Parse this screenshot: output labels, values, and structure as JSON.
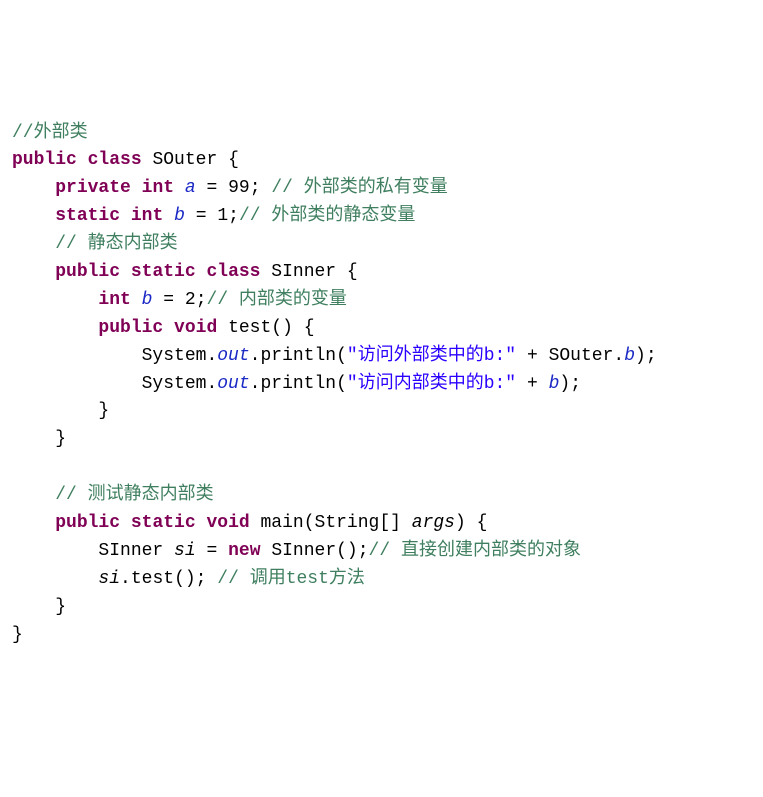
{
  "c": {
    "l1": "//外部类",
    "l4a": "// ",
    "l4b": "外部类的私有变量",
    "l5a": "// ",
    "l5b": "外部类的静态变量",
    "l6": "// 静态内部类",
    "l8a": "// ",
    "l8b": "内部类的变量",
    "l15": "// 测试静态内部类",
    "l17a": "// ",
    "l17b": "直接创建内部类的对象",
    "l18a": "// ",
    "l18b": "调用test方法"
  },
  "kw": {
    "public": "public",
    "class": "class",
    "private": "private",
    "int": "int",
    "static": "static",
    "void": "void",
    "new": "new"
  },
  "id": {
    "SOuter": "SOuter",
    "SInner": "SInner",
    "a": "a",
    "b": "b",
    "test": "test",
    "System": "System",
    "out": "out",
    "println": "println",
    "main": "main",
    "String": "String",
    "args": "args",
    "si": "si"
  },
  "num": {
    "n99": "99",
    "n1": "1",
    "n2": "2"
  },
  "str": {
    "s1": "\"访问外部类中的b:\"",
    "s2": "\"访问内部类中的b:\""
  },
  "chart_data": null
}
